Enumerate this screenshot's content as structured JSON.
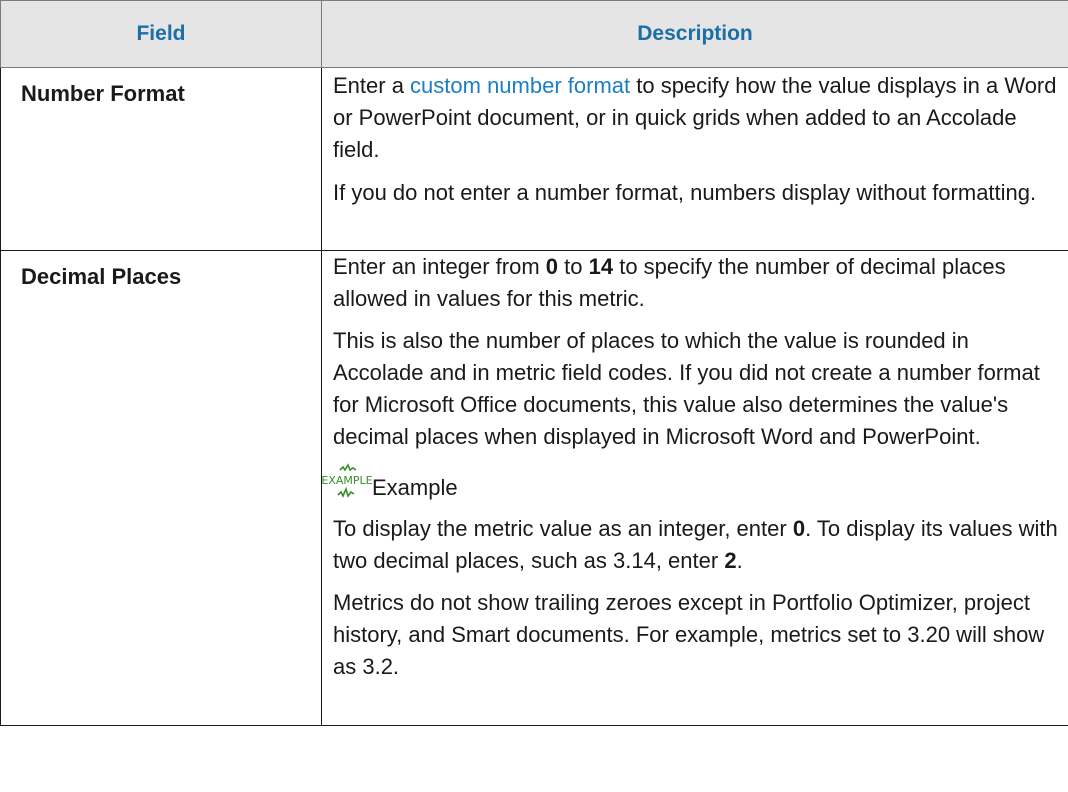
{
  "headers": {
    "field": "Field",
    "description": "Description"
  },
  "rows": [
    {
      "name": "Number Format",
      "p1": {
        "pre": "Enter a ",
        "link": "custom number format",
        "post": " to specify how the value displays in a Word or PowerPoint document, or in quick grids when added to an Accolade field."
      },
      "p2": "If you do not enter a number format, numbers display without formatting."
    },
    {
      "name": "Decimal Places",
      "p1": {
        "pre": "Enter an integer from ",
        "b1": "0",
        "mid": " to ",
        "b2": "14",
        "post": " to specify the number of decimal places allowed in values for this metric."
      },
      "p2": "This is also the number of places to which the value is rounded in Accolade and in metric field codes. If you did not create a number format for Microsoft Office documents, this value also determines the value's decimal places when displayed in Microsoft Word and PowerPoint.",
      "example": {
        "icon": "example-icon",
        "icon_text": "EXAMPLE",
        "label": "Example",
        "text": {
          "pre": "To display the metric value as an integer, enter ",
          "b1": "0",
          "mid": ". To display its values with two decimal places, such as 3.14, enter ",
          "b2": "2",
          "post": "."
        }
      },
      "p3": "Metrics do not show trailing zeroes except in Portfolio Optimizer, project history, and Smart documents. For example, metrics set to 3.20 will show as 3.2."
    }
  ],
  "colors": {
    "header_bg": "#e5e5e5",
    "header_text": "#1b6ea8",
    "link": "#1b7fc4",
    "icon_green": "#3a8c2e"
  }
}
